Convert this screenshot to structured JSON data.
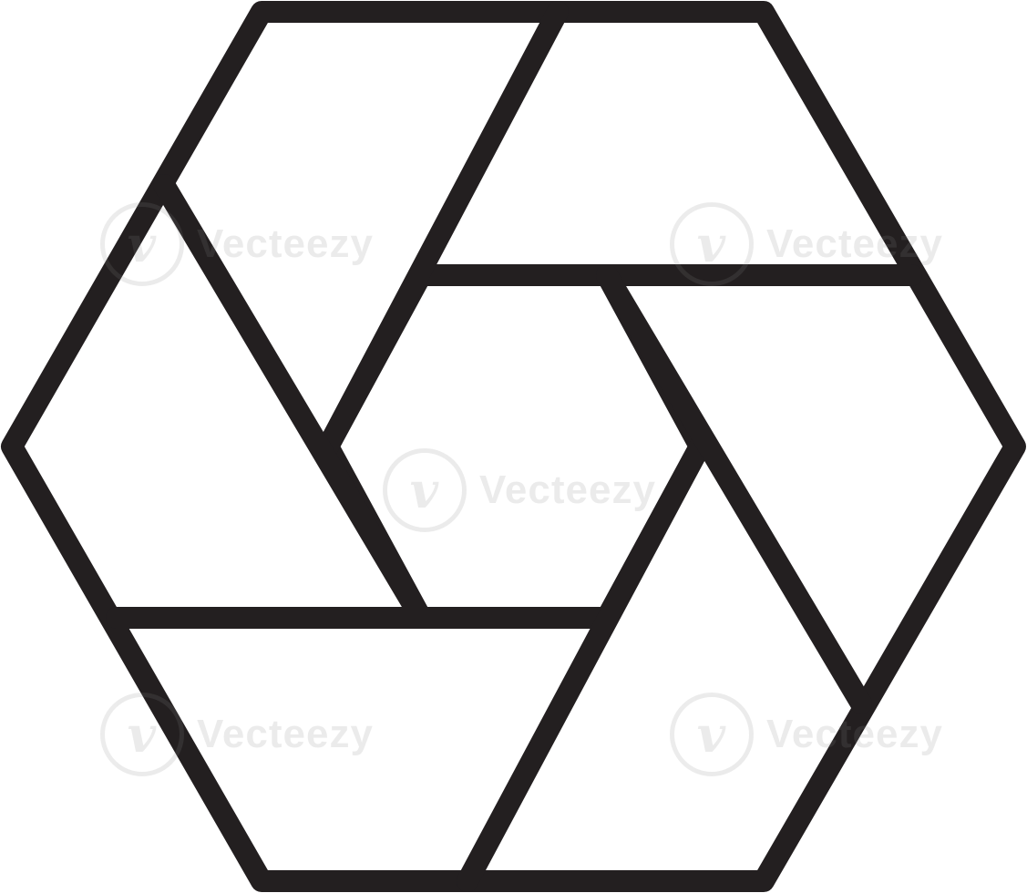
{
  "icon": {
    "name": "shutter-aperture-hexagon-icon",
    "stroke_color": "#231f20",
    "fill_color": "#ffffff"
  },
  "watermark": {
    "text": "Vecteezy",
    "mark_glyph": "v",
    "color": "#8a8a8a"
  }
}
